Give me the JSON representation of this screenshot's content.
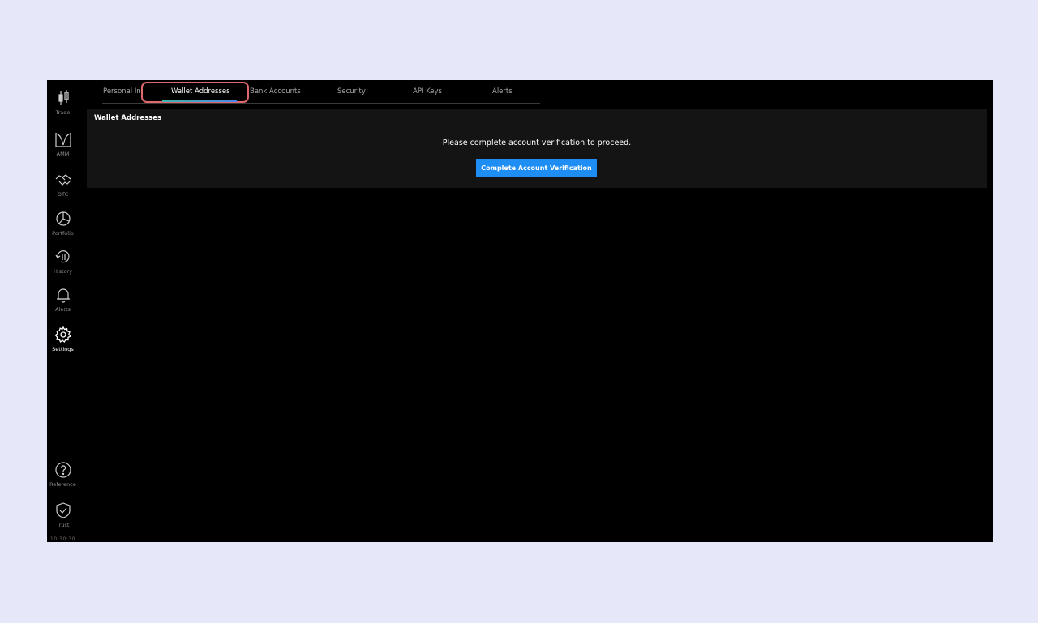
{
  "sidebar": {
    "items": [
      {
        "label": "Trade",
        "icon": "candlestick-icon"
      },
      {
        "label": "AMM",
        "icon": "amm-chart-icon"
      },
      {
        "label": "OTC",
        "icon": "handshake-icon"
      },
      {
        "label": "Portfolio",
        "icon": "pie-chart-icon"
      },
      {
        "label": "History",
        "icon": "history-icon"
      },
      {
        "label": "Alerts",
        "icon": "bell-icon"
      },
      {
        "label": "Settings",
        "icon": "gear-icon",
        "active": true
      }
    ],
    "bottom_items": [
      {
        "label": "Reference",
        "icon": "question-circle-icon"
      },
      {
        "label": "Trust",
        "icon": "shield-check-icon"
      }
    ],
    "clock": "10:30:30"
  },
  "tabs": [
    {
      "label": "Personal Info"
    },
    {
      "label": "Wallet Addresses",
      "active": true
    },
    {
      "label": "Bank Accounts"
    },
    {
      "label": "Security"
    },
    {
      "label": "API Keys"
    },
    {
      "label": "Alerts"
    }
  ],
  "panel": {
    "title": "Wallet Addresses",
    "message": "Please complete account verification to proceed.",
    "button_label": "Complete Account Verification"
  },
  "colors": {
    "page_background": "#e6e7f8",
    "app_background": "#000000",
    "panel_background": "#141414",
    "accent_button": "#1e8ef5",
    "highlight_ring": "#e0686d"
  }
}
